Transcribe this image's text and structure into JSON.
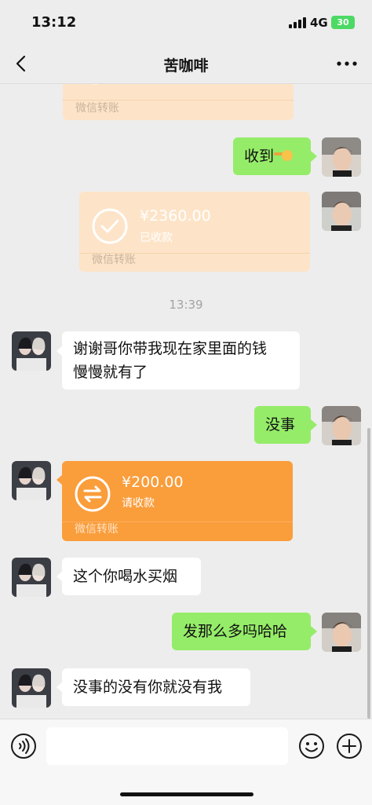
{
  "status": {
    "time": "13:12",
    "network": "4G",
    "battery": "30"
  },
  "nav": {
    "title": "苦咖啡"
  },
  "messages": {
    "top_transfer": {
      "footer": "微信转账",
      "color": "#fde4c8"
    },
    "m1": {
      "text": "收到"
    },
    "m2": {
      "amount": "¥2360.00",
      "status": "已收款",
      "footer": "微信转账",
      "color": "#fde4c8"
    },
    "timestamp": "13:39",
    "m3": {
      "line1": "谢谢哥你带我现在家里面的钱",
      "line2": "慢慢就有了"
    },
    "m4": {
      "text": "没事"
    },
    "m5": {
      "amount": "¥200.00",
      "status": "请收款",
      "footer": "微信转账",
      "color": "#fa9d3b"
    },
    "m6": {
      "text": "这个你喝水买烟"
    },
    "m7": {
      "text": "发那么多吗哈哈"
    },
    "m8": {
      "text": "没事的没有你就没有我"
    }
  },
  "colors": {
    "sent_bubble": "#95ec69",
    "received_bubble": "#ffffff",
    "background": "#ededed"
  },
  "icons": [
    "back-icon",
    "more-icon",
    "voice-icon",
    "emoji-icon",
    "plus-icon",
    "check-circle-icon",
    "transfer-arrows-icon"
  ]
}
